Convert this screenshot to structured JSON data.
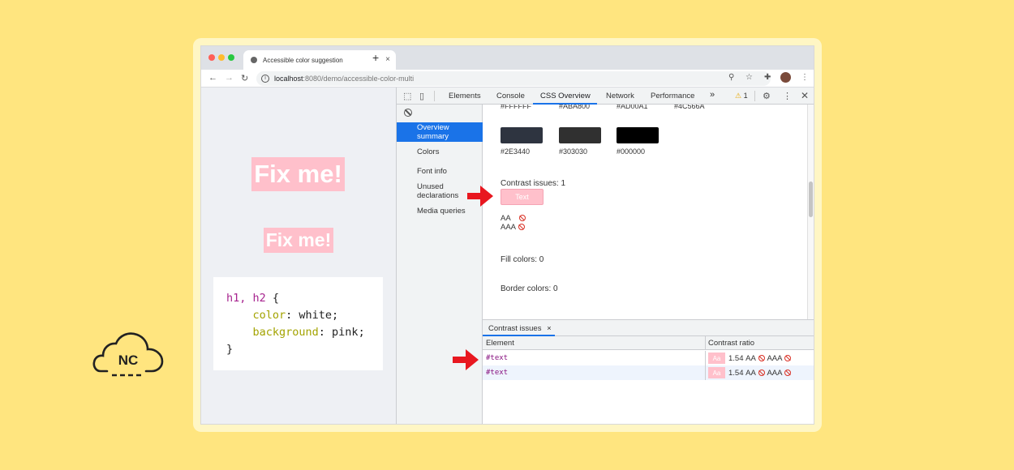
{
  "browser": {
    "tab_title": "Accessible color suggestion",
    "new_tab_label": "+",
    "tab_close_label": "×",
    "url_host": "localhost",
    "url_path": ":8080/demo/accessible-color-multi",
    "traffic_colors": [
      "#FF5F57",
      "#FEBC2E",
      "#28C840"
    ]
  },
  "page": {
    "heading1": "Fix me!",
    "heading2": "Fix me!",
    "code": {
      "line1_sel": "h1, h2",
      "line1_rest": " {",
      "line2_prop": "color",
      "line2_rest": ": white;",
      "line3_prop": "background",
      "line3_rest": ": pink;",
      "line4": "}"
    }
  },
  "devtools": {
    "tabs": [
      "Elements",
      "Console",
      "CSS Overview",
      "Network",
      "Performance"
    ],
    "active_tab": "CSS Overview",
    "more_tabs": "»",
    "warning_count": "1",
    "sidebar": {
      "items": [
        "Overview summary",
        "Colors",
        "Font info",
        "Unused declarations",
        "Media queries"
      ],
      "active": "Overview summary"
    },
    "overview": {
      "top_hex": [
        "#FFFFFF",
        "#ABA800",
        "#AD00A1",
        "#4C566A"
      ],
      "swatches": [
        {
          "hex": "#2E3440",
          "color": "#2E3440"
        },
        {
          "hex": "#303030",
          "color": "#303030"
        },
        {
          "hex": "#000000",
          "color": "#000000"
        }
      ],
      "contrast_issues_label": "Contrast issues: 1",
      "text_chip": "Text",
      "aa_label": "AA",
      "aaa_label": "AAA",
      "fill_colors_label": "Fill colors: 0",
      "border_colors_label": "Border colors: 0"
    },
    "drawer": {
      "tab_label": "Contrast issues",
      "tab_close": "×",
      "col_element": "Element",
      "col_ratio": "Contrast ratio",
      "rows": [
        {
          "element": "#text",
          "chip": "Aa",
          "ratio": "1.54",
          "aa": "AA",
          "aaa": "AAA"
        },
        {
          "element": "#text",
          "chip": "Aa",
          "ratio": "1.54",
          "aa": "AA",
          "aaa": "AAA"
        }
      ]
    }
  },
  "logo": {
    "text": "NC"
  },
  "colors": {
    "background": "#FFE57F",
    "accent": "#1A73E8",
    "pink": "#FFC0CB",
    "arrow": "#E8171F"
  }
}
